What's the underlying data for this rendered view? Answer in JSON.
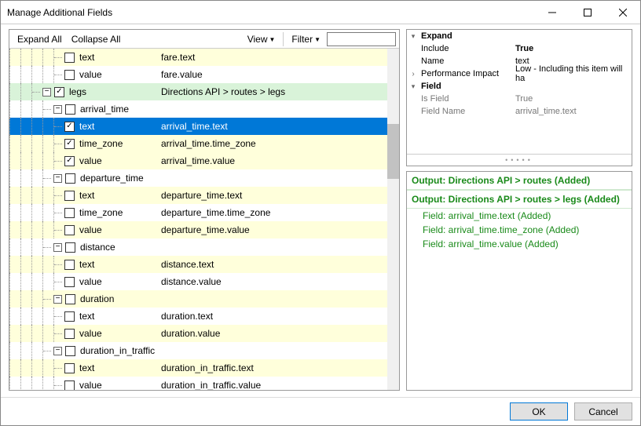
{
  "title": "Manage Additional Fields",
  "toolbar": {
    "expand_all": "Expand All",
    "collapse_all": "Collapse All",
    "view": "View",
    "filter": "Filter",
    "filter_value": ""
  },
  "tree": [
    {
      "depth": 3,
      "checked": false,
      "toggle": "",
      "name": "text",
      "desc": "fare.text",
      "bg": "even"
    },
    {
      "depth": 3,
      "checked": false,
      "toggle": "",
      "name": "value",
      "desc": "fare.value",
      "bg": ""
    },
    {
      "depth": 1,
      "checked": true,
      "toggle": "-",
      "name": "legs",
      "desc": "Directions API > routes > legs",
      "bg": "green",
      "rail": "orange"
    },
    {
      "depth": 2,
      "checked": false,
      "toggle": "-",
      "name": "arrival_time",
      "desc": "",
      "bg": ""
    },
    {
      "depth": 3,
      "checked": true,
      "toggle": "",
      "name": "text",
      "desc": "arrival_time.text",
      "bg": "sel",
      "rail": "orange"
    },
    {
      "depth": 3,
      "checked": true,
      "toggle": "",
      "name": "time_zone",
      "desc": "arrival_time.time_zone",
      "bg": "even",
      "rail": "orange"
    },
    {
      "depth": 3,
      "checked": true,
      "toggle": "",
      "name": "value",
      "desc": "arrival_time.value",
      "bg": "even",
      "rail": "orange"
    },
    {
      "depth": 2,
      "checked": false,
      "toggle": "-",
      "name": "departure_time",
      "desc": "",
      "bg": ""
    },
    {
      "depth": 3,
      "checked": false,
      "toggle": "",
      "name": "text",
      "desc": "departure_time.text",
      "bg": "even"
    },
    {
      "depth": 3,
      "checked": false,
      "toggle": "",
      "name": "time_zone",
      "desc": "departure_time.time_zone",
      "bg": ""
    },
    {
      "depth": 3,
      "checked": false,
      "toggle": "",
      "name": "value",
      "desc": "departure_time.value",
      "bg": "even"
    },
    {
      "depth": 2,
      "checked": false,
      "toggle": "-",
      "name": "distance",
      "desc": "",
      "bg": ""
    },
    {
      "depth": 3,
      "checked": false,
      "toggle": "",
      "name": "text",
      "desc": "distance.text",
      "bg": "even"
    },
    {
      "depth": 3,
      "checked": false,
      "toggle": "",
      "name": "value",
      "desc": "distance.value",
      "bg": ""
    },
    {
      "depth": 2,
      "checked": false,
      "toggle": "-",
      "name": "duration",
      "desc": "",
      "bg": "even"
    },
    {
      "depth": 3,
      "checked": false,
      "toggle": "",
      "name": "text",
      "desc": "duration.text",
      "bg": ""
    },
    {
      "depth": 3,
      "checked": false,
      "toggle": "",
      "name": "value",
      "desc": "duration.value",
      "bg": "even"
    },
    {
      "depth": 2,
      "checked": false,
      "toggle": "-",
      "name": "duration_in_traffic",
      "desc": "",
      "bg": ""
    },
    {
      "depth": 3,
      "checked": false,
      "toggle": "",
      "name": "text",
      "desc": "duration_in_traffic.text",
      "bg": "even"
    },
    {
      "depth": 3,
      "checked": false,
      "toggle": "",
      "name": "value",
      "desc": "duration_in_traffic.value",
      "bg": ""
    }
  ],
  "props": {
    "cat1": "Expand",
    "include_k": "Include",
    "include_v": "True",
    "name_k": "Name",
    "name_v": "text",
    "perf_k": "Performance Impact",
    "perf_v": "Low - Including this item will ha",
    "cat2": "Field",
    "isfield_k": "Is Field",
    "isfield_v": "True",
    "fname_k": "Field Name",
    "fname_v": "arrival_time.text"
  },
  "log": {
    "g1": "Output: Directions API > routes (Added)",
    "g2": "Output: Directions API > routes > legs (Added)",
    "i1": "Field: arrival_time.text (Added)",
    "i2": "Field: arrival_time.time_zone (Added)",
    "i3": "Field: arrival_time.value (Added)"
  },
  "buttons": {
    "ok": "OK",
    "cancel": "Cancel"
  }
}
